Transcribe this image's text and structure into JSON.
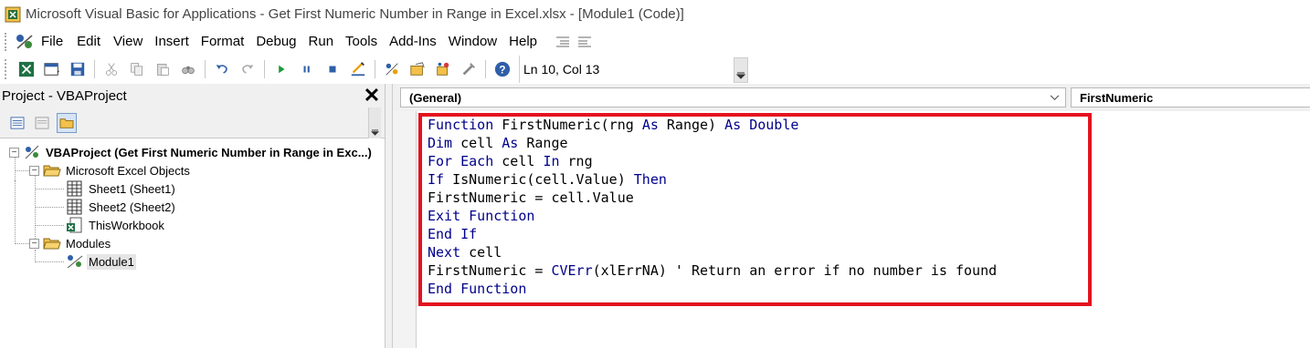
{
  "window": {
    "title": "Microsoft Visual Basic for Applications - Get First Numeric Number in Range in Excel.xlsx - [Module1 (Code)]"
  },
  "menu": {
    "items": [
      "File",
      "Edit",
      "View",
      "Insert",
      "Format",
      "Debug",
      "Run",
      "Tools",
      "Add-Ins",
      "Window",
      "Help"
    ]
  },
  "toolbar": {
    "position": "Ln 10, Col 13",
    "icons": [
      "view-excel-icon",
      "insert-userform-icon",
      "save-icon",
      "cut-icon",
      "copy-icon",
      "paste-icon",
      "find-icon",
      "undo-icon",
      "redo-icon",
      "run-icon",
      "break-icon",
      "reset-icon",
      "design-mode-icon",
      "project-explorer-icon",
      "properties-icon",
      "object-browser-icon",
      "toolbox-icon",
      "help-icon"
    ]
  },
  "project_panel": {
    "title": "Project - VBAProject",
    "close_glyph": "✕",
    "tree": {
      "root": "VBAProject (Get First Numeric Number in Range in Exc...)",
      "excel_objects": "Microsoft Excel Objects",
      "sheet1": "Sheet1 (Sheet1)",
      "sheet2": "Sheet2 (Sheet2)",
      "workbook": "ThisWorkbook",
      "modules": "Modules",
      "module1": "Module1"
    }
  },
  "code_window": {
    "object_combo": "(General)",
    "procedure_combo": "FirstNumeric",
    "lines": [
      [
        {
          "t": "Function",
          "k": true
        },
        {
          "t": " FirstNumeric(rng ",
          "k": false
        },
        {
          "t": "As",
          "k": true
        },
        {
          "t": " Range) ",
          "k": false
        },
        {
          "t": "As",
          "k": true
        },
        {
          "t": " ",
          "k": false
        },
        {
          "t": "Double",
          "k": true
        }
      ],
      [
        {
          "t": "Dim",
          "k": true
        },
        {
          "t": " cell ",
          "k": false
        },
        {
          "t": "As",
          "k": true
        },
        {
          "t": " Range",
          "k": false
        }
      ],
      [
        {
          "t": "For Each",
          "k": true
        },
        {
          "t": " cell ",
          "k": false
        },
        {
          "t": "In",
          "k": true
        },
        {
          "t": " rng",
          "k": false
        }
      ],
      [
        {
          "t": "If",
          "k": true
        },
        {
          "t": " IsNumeric(cell.Value) ",
          "k": false
        },
        {
          "t": "Then",
          "k": true
        }
      ],
      [
        {
          "t": "FirstNumeric = cell.Value",
          "k": false
        }
      ],
      [
        {
          "t": "Exit Function",
          "k": true
        }
      ],
      [
        {
          "t": "End If",
          "k": true
        }
      ],
      [
        {
          "t": "Next",
          "k": true
        },
        {
          "t": " cell",
          "k": false
        }
      ],
      [
        {
          "t": "FirstNumeric = ",
          "k": false
        },
        {
          "t": "CVErr",
          "k": true
        },
        {
          "t": "(xlErrNA) ' Return an error if no number is found",
          "k": false
        }
      ],
      [
        {
          "t": "End Function",
          "k": true
        }
      ]
    ]
  },
  "colors": {
    "keyword": "#00008b",
    "highlight_border": "#e3131f"
  }
}
